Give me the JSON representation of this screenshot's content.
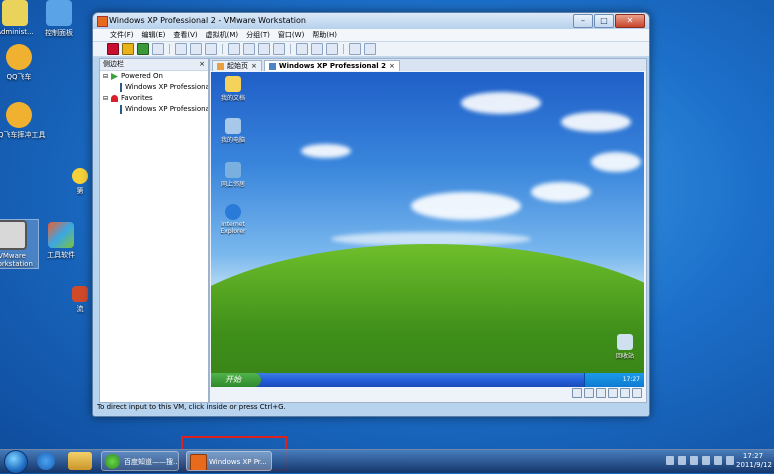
{
  "desktop": {
    "icons": [
      {
        "label": "Administ..."
      },
      {
        "label": "控制面板"
      },
      {
        "label": "QQ飞车"
      },
      {
        "label": "QQ飞车摔冲工具"
      },
      {
        "label": "VMware Workstation"
      },
      {
        "label": "工具软件"
      },
      {
        "label": "第"
      },
      {
        "label": "流"
      }
    ]
  },
  "window": {
    "title": "Windows XP Professional 2 - VMware Workstation",
    "buttons": {
      "minimize": "–",
      "maximize": "□",
      "close": "✕"
    },
    "menu": [
      "文件(F)",
      "编辑(E)",
      "查看(V)",
      "虚拟机(M)",
      "分组(T)",
      "窗口(W)",
      "帮助(H)"
    ],
    "sidebar": {
      "title": "侧边栏",
      "close": "×",
      "tree": [
        {
          "label": "Powered On",
          "level": 0
        },
        {
          "label": "Windows XP Professional 2",
          "level": 1
        },
        {
          "label": "Favorites",
          "level": 0
        },
        {
          "label": "Windows XP Professional",
          "level": 1
        }
      ]
    },
    "tabs": [
      {
        "label": "起始页",
        "close": "×"
      },
      {
        "label": "Windows XP Professional 2",
        "close": "×"
      }
    ],
    "guest": {
      "icons": [
        {
          "label": "我的文档"
        },
        {
          "label": "我的电脑"
        },
        {
          "label": "网上邻居"
        },
        {
          "label": "Internet Explorer"
        },
        {
          "label": "回收站"
        }
      ],
      "start_label": "开始",
      "clock": "17:27"
    },
    "status_text": "To direct input to this VM, click inside or press Ctrl+G."
  },
  "taskbar": {
    "tasks": [
      {
        "label": "百度知道——搜..."
      },
      {
        "label": "Windows XP Pr..."
      }
    ],
    "clock_time": "17:27",
    "clock_date": "2011/9/12"
  }
}
